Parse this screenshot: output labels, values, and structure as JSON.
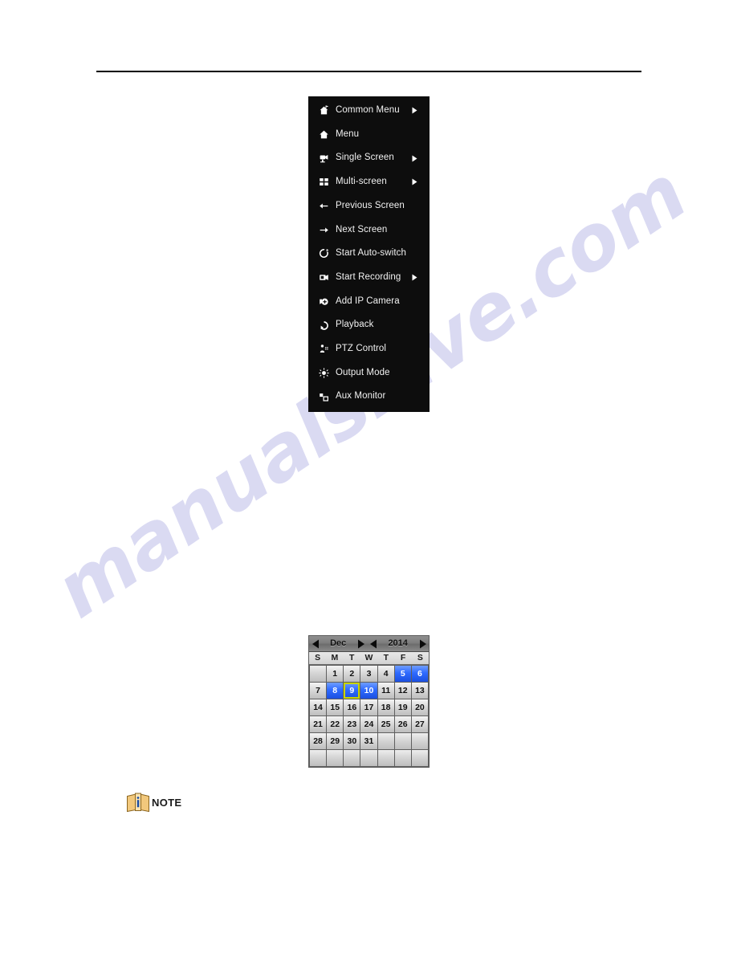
{
  "page": {
    "watermark_text": "manualshive.com",
    "background_color": "#ffffff",
    "rule_color": "#000000"
  },
  "context_menu": {
    "background_color": "#0d0d0d",
    "text_color": "#f2f2f2",
    "items": [
      {
        "label": "Common Menu",
        "icon": "home-flag-icon",
        "has_submenu": true
      },
      {
        "label": "Menu",
        "icon": "home-icon",
        "has_submenu": false
      },
      {
        "label": "Single Screen",
        "icon": "single-screen-icon",
        "has_submenu": true
      },
      {
        "label": "Multi-screen",
        "icon": "multi-screen-icon",
        "has_submenu": true
      },
      {
        "label": "Previous Screen",
        "icon": "arrow-left-icon",
        "has_submenu": false
      },
      {
        "label": "Next Screen",
        "icon": "arrow-right-icon",
        "has_submenu": false
      },
      {
        "label": "Start Auto-switch",
        "icon": "refresh-cycle-icon",
        "has_submenu": false
      },
      {
        "label": "Start Recording",
        "icon": "camcorder-icon",
        "has_submenu": true
      },
      {
        "label": "Add IP Camera",
        "icon": "camera-plus-icon",
        "has_submenu": false
      },
      {
        "label": "Playback",
        "icon": "play-circle-icon",
        "has_submenu": false
      },
      {
        "label": "PTZ Control",
        "icon": "ptz-joystick-icon",
        "has_submenu": false
      },
      {
        "label": "Output Mode",
        "icon": "brightness-sun-icon",
        "has_submenu": false
      },
      {
        "label": "Aux Monitor",
        "icon": "aux-monitor-icon",
        "has_submenu": false
      }
    ]
  },
  "calendar": {
    "month": "Dec",
    "year": "2014",
    "prev_month_icon": "triangle-left-icon",
    "next_month_icon": "triangle-right-icon",
    "prev_year_icon": "triangle-left-icon",
    "next_year_icon": "triangle-right-icon",
    "day_headers": [
      "S",
      "M",
      "T",
      "W",
      "T",
      "F",
      "S"
    ],
    "selected_day": 9,
    "marked_days": [
      5,
      6,
      8,
      9,
      10
    ],
    "highlight_color": "#2f6bff",
    "selection_outline_color": "#c8d400",
    "cells": [
      "",
      "1",
      "2",
      "3",
      "4",
      "5",
      "6",
      "7",
      "8",
      "9",
      "10",
      "11",
      "12",
      "13",
      "14",
      "15",
      "16",
      "17",
      "18",
      "19",
      "20",
      "21",
      "22",
      "23",
      "24",
      "25",
      "26",
      "27",
      "28",
      "29",
      "30",
      "31",
      "",
      "",
      "",
      "",
      "",
      "",
      "",
      "",
      "",
      ""
    ]
  },
  "note": {
    "label": "NOTE",
    "icon": "note-book-info-icon",
    "icon_color": "#f5c87a",
    "info_color": "#1b4fa8"
  }
}
